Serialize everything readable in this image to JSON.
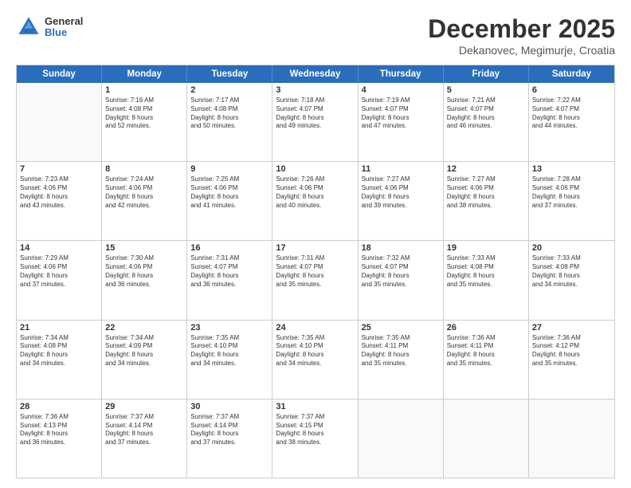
{
  "header": {
    "logo_general": "General",
    "logo_blue": "Blue",
    "month_title": "December 2025",
    "location": "Dekanovec, Megimurje, Croatia"
  },
  "weekdays": [
    "Sunday",
    "Monday",
    "Tuesday",
    "Wednesday",
    "Thursday",
    "Friday",
    "Saturday"
  ],
  "rows": [
    [
      {
        "day": "",
        "text": ""
      },
      {
        "day": "1",
        "text": "Sunrise: 7:16 AM\nSunset: 4:08 PM\nDaylight: 8 hours\nand 52 minutes."
      },
      {
        "day": "2",
        "text": "Sunrise: 7:17 AM\nSunset: 4:08 PM\nDaylight: 8 hours\nand 50 minutes."
      },
      {
        "day": "3",
        "text": "Sunrise: 7:18 AM\nSunset: 4:07 PM\nDaylight: 8 hours\nand 49 minutes."
      },
      {
        "day": "4",
        "text": "Sunrise: 7:19 AM\nSunset: 4:07 PM\nDaylight: 8 hours\nand 47 minutes."
      },
      {
        "day": "5",
        "text": "Sunrise: 7:21 AM\nSunset: 4:07 PM\nDaylight: 8 hours\nand 46 minutes."
      },
      {
        "day": "6",
        "text": "Sunrise: 7:22 AM\nSunset: 4:07 PM\nDaylight: 8 hours\nand 44 minutes."
      }
    ],
    [
      {
        "day": "7",
        "text": "Sunrise: 7:23 AM\nSunset: 4:06 PM\nDaylight: 8 hours\nand 43 minutes."
      },
      {
        "day": "8",
        "text": "Sunrise: 7:24 AM\nSunset: 4:06 PM\nDaylight: 8 hours\nand 42 minutes."
      },
      {
        "day": "9",
        "text": "Sunrise: 7:25 AM\nSunset: 4:06 PM\nDaylight: 8 hours\nand 41 minutes."
      },
      {
        "day": "10",
        "text": "Sunrise: 7:26 AM\nSunset: 4:06 PM\nDaylight: 8 hours\nand 40 minutes."
      },
      {
        "day": "11",
        "text": "Sunrise: 7:27 AM\nSunset: 4:06 PM\nDaylight: 8 hours\nand 39 minutes."
      },
      {
        "day": "12",
        "text": "Sunrise: 7:27 AM\nSunset: 4:06 PM\nDaylight: 8 hours\nand 38 minutes."
      },
      {
        "day": "13",
        "text": "Sunrise: 7:28 AM\nSunset: 4:06 PM\nDaylight: 8 hours\nand 37 minutes."
      }
    ],
    [
      {
        "day": "14",
        "text": "Sunrise: 7:29 AM\nSunset: 4:06 PM\nDaylight: 8 hours\nand 37 minutes."
      },
      {
        "day": "15",
        "text": "Sunrise: 7:30 AM\nSunset: 4:06 PM\nDaylight: 8 hours\nand 36 minutes."
      },
      {
        "day": "16",
        "text": "Sunrise: 7:31 AM\nSunset: 4:07 PM\nDaylight: 8 hours\nand 36 minutes."
      },
      {
        "day": "17",
        "text": "Sunrise: 7:31 AM\nSunset: 4:07 PM\nDaylight: 8 hours\nand 35 minutes."
      },
      {
        "day": "18",
        "text": "Sunrise: 7:32 AM\nSunset: 4:07 PM\nDaylight: 8 hours\nand 35 minutes."
      },
      {
        "day": "19",
        "text": "Sunrise: 7:33 AM\nSunset: 4:08 PM\nDaylight: 8 hours\nand 35 minutes."
      },
      {
        "day": "20",
        "text": "Sunrise: 7:33 AM\nSunset: 4:08 PM\nDaylight: 8 hours\nand 34 minutes."
      }
    ],
    [
      {
        "day": "21",
        "text": "Sunrise: 7:34 AM\nSunset: 4:08 PM\nDaylight: 8 hours\nand 34 minutes."
      },
      {
        "day": "22",
        "text": "Sunrise: 7:34 AM\nSunset: 4:09 PM\nDaylight: 8 hours\nand 34 minutes."
      },
      {
        "day": "23",
        "text": "Sunrise: 7:35 AM\nSunset: 4:10 PM\nDaylight: 8 hours\nand 34 minutes."
      },
      {
        "day": "24",
        "text": "Sunrise: 7:35 AM\nSunset: 4:10 PM\nDaylight: 8 hours\nand 34 minutes."
      },
      {
        "day": "25",
        "text": "Sunrise: 7:35 AM\nSunset: 4:11 PM\nDaylight: 8 hours\nand 35 minutes."
      },
      {
        "day": "26",
        "text": "Sunrise: 7:36 AM\nSunset: 4:11 PM\nDaylight: 8 hours\nand 35 minutes."
      },
      {
        "day": "27",
        "text": "Sunrise: 7:36 AM\nSunset: 4:12 PM\nDaylight: 8 hours\nand 35 minutes."
      }
    ],
    [
      {
        "day": "28",
        "text": "Sunrise: 7:36 AM\nSunset: 4:13 PM\nDaylight: 8 hours\nand 36 minutes."
      },
      {
        "day": "29",
        "text": "Sunrise: 7:37 AM\nSunset: 4:14 PM\nDaylight: 8 hours\nand 37 minutes."
      },
      {
        "day": "30",
        "text": "Sunrise: 7:37 AM\nSunset: 4:14 PM\nDaylight: 8 hours\nand 37 minutes."
      },
      {
        "day": "31",
        "text": "Sunrise: 7:37 AM\nSunset: 4:15 PM\nDaylight: 8 hours\nand 38 minutes."
      },
      {
        "day": "",
        "text": ""
      },
      {
        "day": "",
        "text": ""
      },
      {
        "day": "",
        "text": ""
      }
    ]
  ]
}
